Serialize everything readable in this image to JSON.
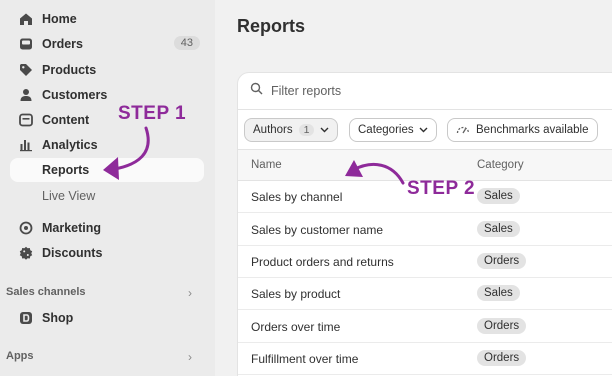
{
  "sidebar": {
    "items": [
      {
        "label": "Home",
        "icon": "home-icon"
      },
      {
        "label": "Orders",
        "icon": "inbox-icon",
        "count": "43"
      },
      {
        "label": "Products",
        "icon": "tag-icon"
      },
      {
        "label": "Customers",
        "icon": "person-icon"
      },
      {
        "label": "Content",
        "icon": "content-icon"
      },
      {
        "label": "Analytics",
        "icon": "bar-chart-icon"
      },
      {
        "label": "Reports",
        "active": true
      },
      {
        "label": "Live View"
      },
      {
        "label": "Marketing",
        "icon": "target-icon"
      },
      {
        "label": "Discounts",
        "icon": "discount-icon"
      }
    ],
    "sections": {
      "sales_channels": "Sales channels",
      "shop": "Shop",
      "apps": "Apps"
    }
  },
  "main": {
    "title": "Reports",
    "search_placeholder": "Filter reports",
    "filters": {
      "authors": "Authors",
      "authors_count": "1",
      "categories": "Categories",
      "benchmarks": "Benchmarks available"
    },
    "columns": {
      "name": "Name",
      "category": "Category"
    },
    "rows": [
      {
        "name": "Sales by channel",
        "category": "Sales"
      },
      {
        "name": "Sales by customer name",
        "category": "Sales"
      },
      {
        "name": "Product orders and returns",
        "category": "Orders"
      },
      {
        "name": "Sales by product",
        "category": "Sales"
      },
      {
        "name": "Orders over time",
        "category": "Orders"
      },
      {
        "name": "Fulfillment over time",
        "category": "Orders"
      }
    ]
  },
  "annotations": {
    "step1": "STEP 1",
    "step2": "STEP 2",
    "color": "#8e2a9a"
  }
}
